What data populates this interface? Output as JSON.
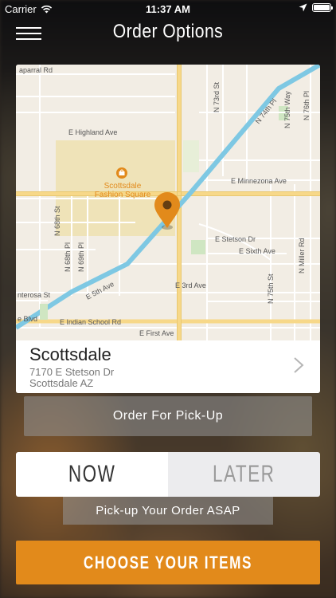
{
  "status_bar": {
    "carrier": "Carrier",
    "time": "11:37 AM",
    "battery_level": 1.0
  },
  "nav": {
    "title": "Order Options"
  },
  "map": {
    "poi": {
      "name_line1": "Scottsdale",
      "name_line2": "Fashion Square"
    },
    "streets": {
      "chaparral": "aparral Rd",
      "highland": "E Highland Ave",
      "minnezona": "E Minnezona Ave",
      "stetson": "E Stetson Dr",
      "sixth": "E Sixth Ave",
      "fifth": "E 5th Ave",
      "third": "E 3rd Ave",
      "indian_school": "E Indian School Rd",
      "first": "E First Ave",
      "osborn": "e Blvd",
      "monterosa": "nterosa St",
      "n73rd": "N 73rd St",
      "n74th": "N 74th Pl",
      "n75th_way": "N 75th Way",
      "n76th": "N 76th Pl",
      "n68th_st": "N 68th St",
      "n68th_pl": "N 68th Pl",
      "n69th": "N 69th Pl",
      "n75th_st": "N 75th St",
      "miller": "N Miller Rd"
    },
    "accent_color": "#e28a1b"
  },
  "location": {
    "name": "Scottsdale",
    "address_line1": "7170 E Stetson Dr",
    "address_line2": "Scottsdale AZ"
  },
  "order_type_label": "Order For Pick-Up",
  "timing": {
    "now_label": "NOW",
    "later_label": "LATER",
    "selected": "NOW"
  },
  "timing_note": "Pick-up Your Order ASAP",
  "cta_label": "CHOOSE YOUR ITEMS",
  "colors": {
    "accent": "#e28a1b",
    "map_bg": "#f2ede4",
    "canal": "#7ec8e3",
    "major_road": "#f7d889"
  }
}
